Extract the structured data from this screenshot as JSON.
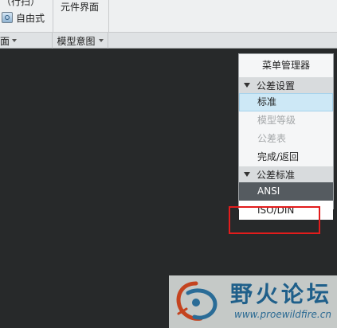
{
  "ribbon": {
    "top_cut_text": "（行扫）",
    "freestyle_label": "自由式",
    "component_interface_label": "元件界面",
    "group_left_label": "面",
    "group_mid_label": "模型意图"
  },
  "menu_manager": {
    "title": "菜单管理器",
    "sections": [
      {
        "label": "公差设置",
        "items": [
          {
            "label": "标准",
            "state": "selected"
          },
          {
            "label": "模型等级",
            "state": "disabled"
          },
          {
            "label": "公差表",
            "state": "disabled"
          },
          {
            "label": "完成/返回",
            "state": "normal"
          }
        ]
      },
      {
        "label": "公差标准",
        "items": [
          {
            "label": "ANSI",
            "state": "active"
          },
          {
            "label": "ISO/DIN",
            "state": "normal"
          }
        ]
      }
    ]
  },
  "watermark": {
    "title": "野火论坛",
    "url": "www.proewildfire.cn"
  },
  "colors": {
    "canvas": "#27292a",
    "highlight_red": "#e21c1c",
    "selected_bg": "#cde8f6",
    "active_item_bg": "#555b60"
  }
}
